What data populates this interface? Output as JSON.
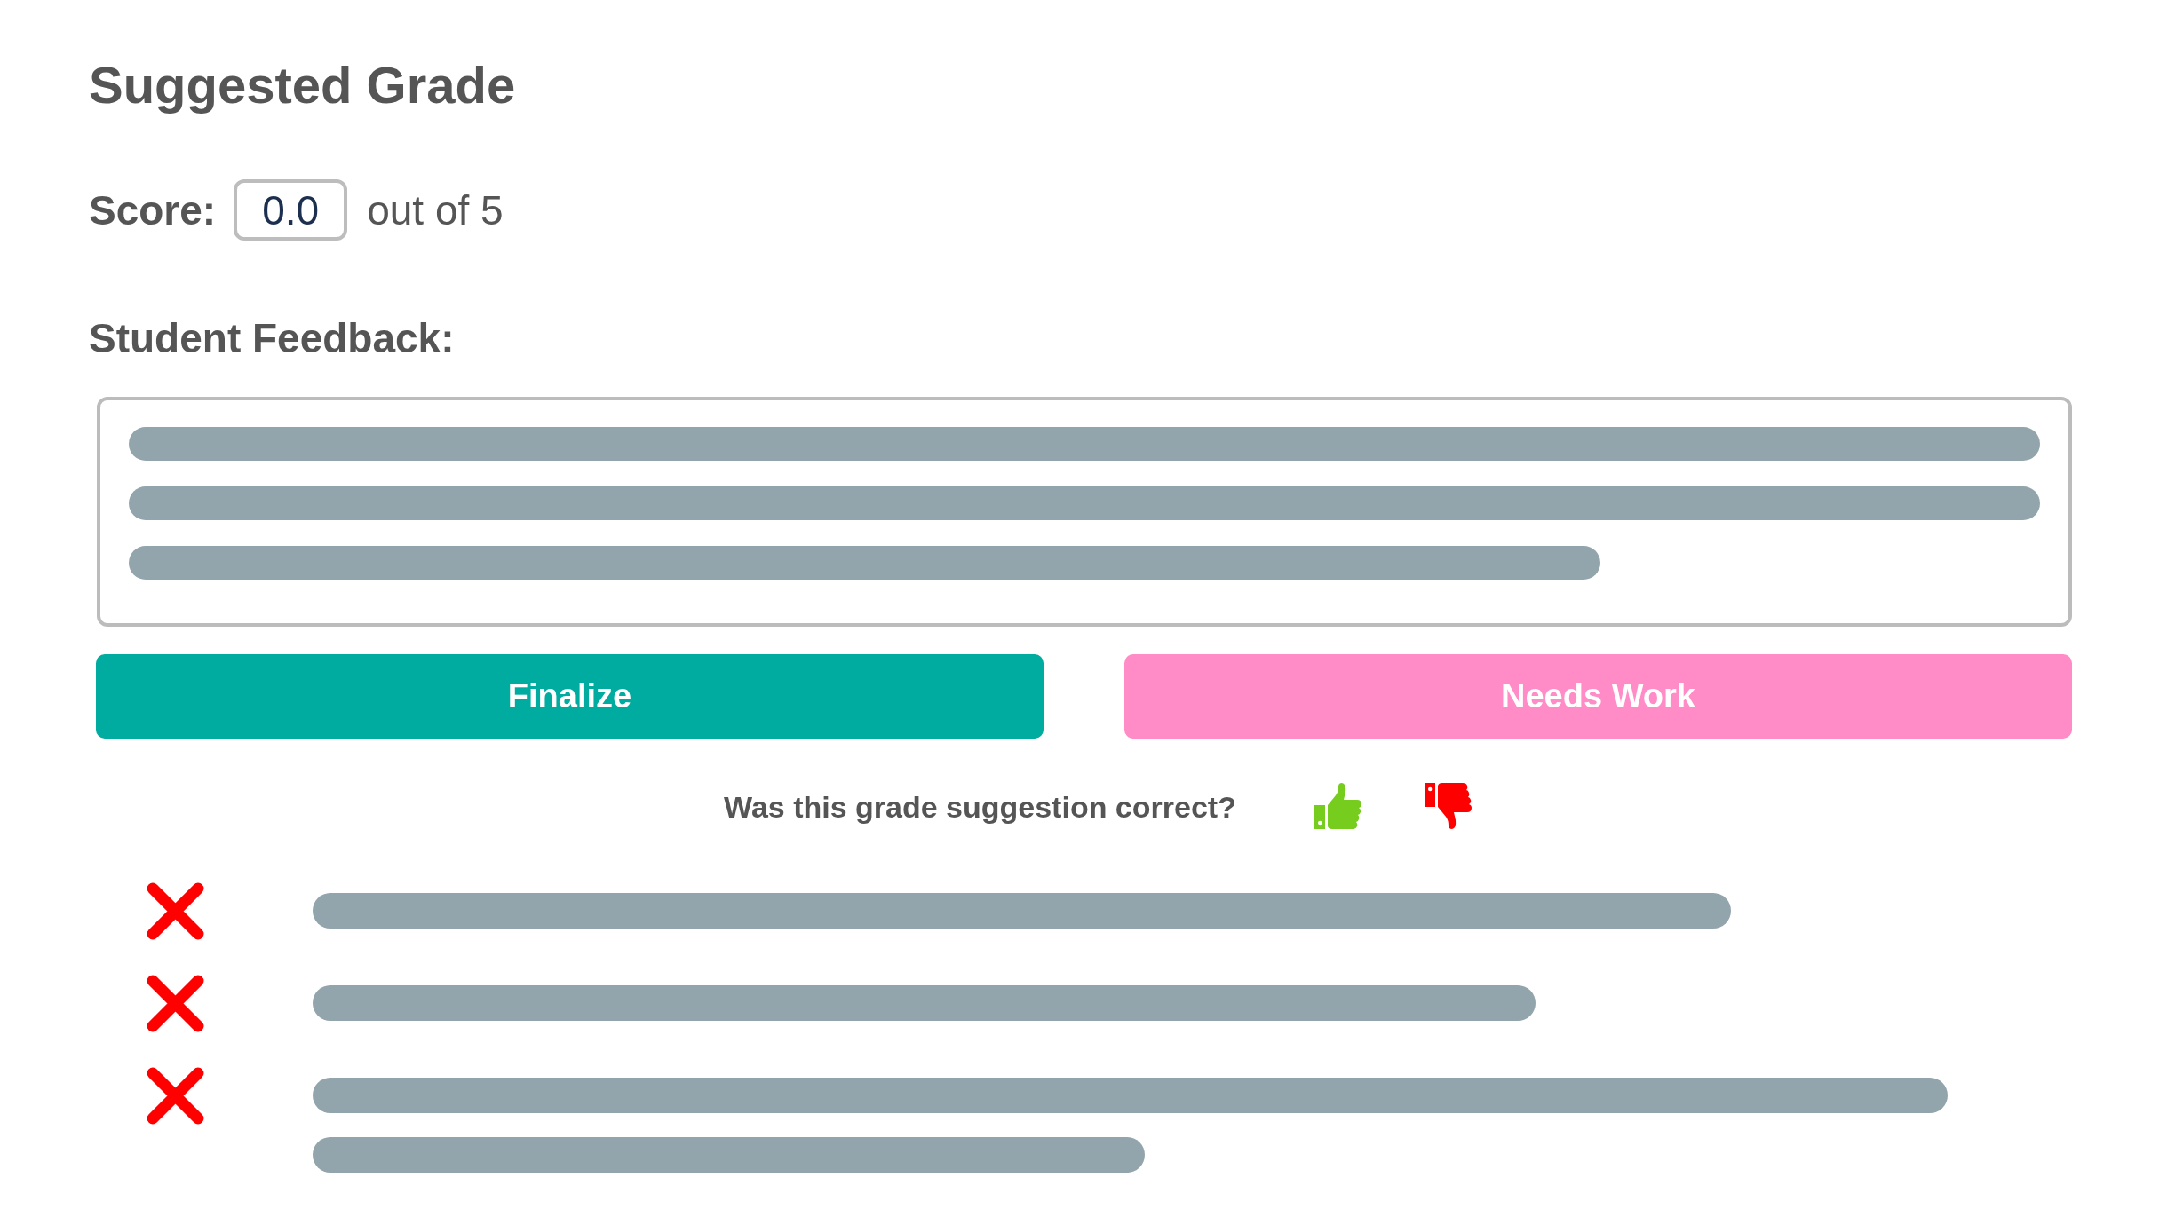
{
  "title": "Suggested Grade",
  "score": {
    "label": "Score:",
    "value": "0.0",
    "suffix": "out of 5"
  },
  "feedback": {
    "label": "Student Feedback:"
  },
  "buttons": [
    {
      "label": "Finalize",
      "kind": "primary"
    },
    {
      "label": "Needs Work",
      "kind": "secondary"
    }
  ],
  "rating_prompt": {
    "text": "Was this grade suggestion correct?"
  },
  "results": [
    {
      "correct": false
    },
    {
      "correct": false
    },
    {
      "correct": false
    }
  ]
}
